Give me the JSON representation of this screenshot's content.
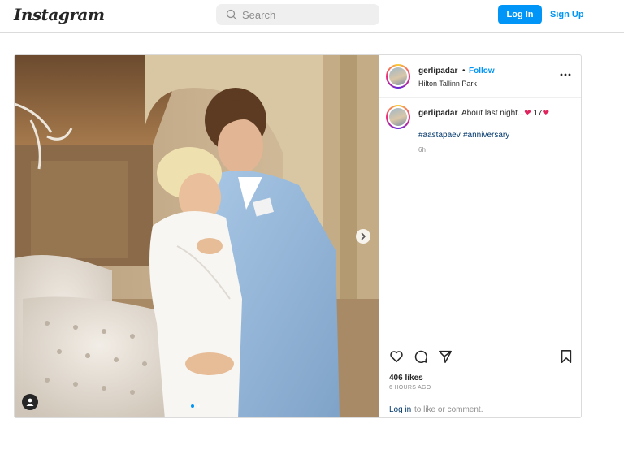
{
  "header": {
    "logo": "Instagram",
    "search_placeholder": "Search",
    "login_label": "Log In",
    "signup_label": "Sign Up"
  },
  "post": {
    "username": "gerlipadar",
    "separator": "•",
    "follow_label": "Follow",
    "location": "Hilton Tallinn Park",
    "caption": {
      "username": "gerlipadar",
      "text": "About last night...",
      "heart1": "❤",
      "number": "17",
      "heart2": "❤",
      "hashtags": [
        "#aastapäev",
        "#anniversary"
      ],
      "time": "6h"
    },
    "likes": "406 likes",
    "posted_ago": "6 HOURS AGO",
    "comment": {
      "login_link": "Log in",
      "rest": "to like or comment."
    },
    "carousel": {
      "slides": 2,
      "active": 1
    }
  },
  "icons": {
    "search": "search-icon",
    "more": "more-options-icon",
    "like": "heart-icon",
    "comment": "comment-icon",
    "share": "share-icon",
    "save": "bookmark-icon",
    "next": "chevron-right-icon",
    "tag": "user-tag-icon"
  },
  "colors": {
    "accent": "#0095f6",
    "hashtag": "#00376b",
    "heart": "#e0245e",
    "muted": "#8e8e8e",
    "border": "#dbdbdb"
  }
}
